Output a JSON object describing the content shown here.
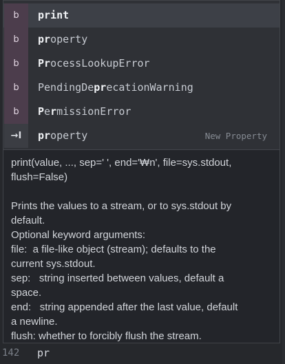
{
  "completion": {
    "items": [
      {
        "kind_icon": "b",
        "match": "pr",
        "rest": "int",
        "full_bold": true,
        "detail": ""
      },
      {
        "kind_icon": "b",
        "match": "pr",
        "rest": "operty",
        "prefix": "",
        "detail": ""
      },
      {
        "kind_icon": "b",
        "match": "Pr",
        "rest": "ocessLookupError",
        "prefix": "",
        "detail": ""
      },
      {
        "kind_icon": "b",
        "prefix": "PendingDe",
        "match": "pr",
        "rest": "ecationWarning",
        "detail": ""
      },
      {
        "kind_icon": "b",
        "match": "P",
        "mid": "e",
        "match2": "r",
        "rest": "missionError",
        "detail": ""
      },
      {
        "kind_icon": "→I",
        "match": "pr",
        "rest": "operty",
        "detail": "New Property"
      }
    ]
  },
  "doc": {
    "lines": [
      "print(value, ..., sep=' ', end='₩n', file=sys.stdout,",
      "flush=False)",
      "",
      "Prints the values to a stream, or to sys.stdout by",
      "default.",
      "Optional keyword arguments:",
      "file:  a file-like object (stream); defaults to the",
      "current sys.stdout.",
      "sep:   string inserted between values, default a",
      "space.",
      "end:   string appended after the last value, default",
      "a newline.",
      "flush: whether to forcibly flush the stream."
    ]
  },
  "editor": {
    "line_number": "142",
    "line_text": "pr"
  }
}
